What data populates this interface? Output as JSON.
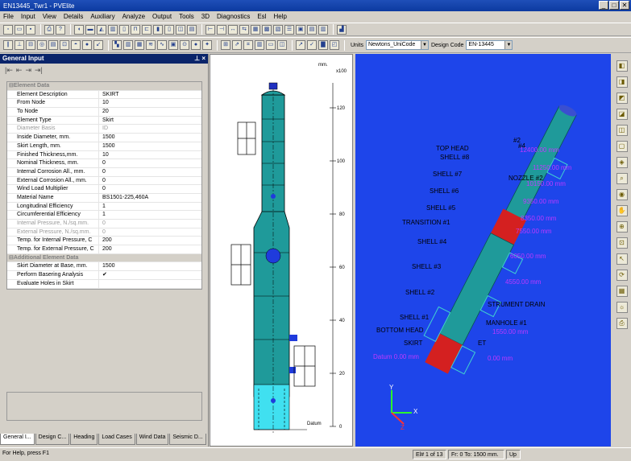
{
  "window": {
    "title": "EN13445_Twr1 - PVElite",
    "controls": [
      "_",
      "□",
      "✕"
    ]
  },
  "menu": [
    "File",
    "Input",
    "View",
    "Details",
    "Auxiliary",
    "Analyze",
    "Output",
    "Tools",
    "3D",
    "Diagnostics",
    "Esl",
    "Help"
  ],
  "toolbar": {
    "units_label": "Units",
    "units_value": "Newtons_UniCode",
    "design_code_label": "Design Code",
    "design_code_value": "EN-13445"
  },
  "panel": {
    "title": "General Input",
    "pin": "⊥ ×",
    "category_element": "Element Data",
    "category_additional": "Additional Element Data",
    "rows": [
      {
        "k": "Element Description",
        "v": "SKIRT"
      },
      {
        "k": "From Node",
        "v": "10"
      },
      {
        "k": "To Node",
        "v": "20"
      },
      {
        "k": "Element Type",
        "v": "Skirt"
      },
      {
        "k": "Diameter Basis",
        "v": "ID",
        "disabled": true
      },
      {
        "k": "Inside Diameter, mm.",
        "v": "1500"
      },
      {
        "k": "Skirt Length, mm.",
        "v": "1500"
      },
      {
        "k": "Finished Thickness,mm.",
        "v": "10"
      },
      {
        "k": "Nominal Thickness, mm.",
        "v": "0"
      },
      {
        "k": "Internal Corrosion All., mm.",
        "v": "0"
      },
      {
        "k": "External Corrosion All., mm.",
        "v": "0"
      },
      {
        "k": "Wind Load Multiplier",
        "v": "0"
      },
      {
        "k": "Material Name",
        "v": "BS1501-225,460A"
      },
      {
        "k": "Longitudinal Efficiency",
        "v": "1"
      },
      {
        "k": "Circumferential Efficiency",
        "v": "1"
      },
      {
        "k": "Internal Pressure, N./sq.mm.",
        "v": "0",
        "disabled": true
      },
      {
        "k": "External Pressure, N./sq.mm.",
        "v": "0",
        "disabled": true
      },
      {
        "k": "Temp. for Internal Pressure, C",
        "v": "200"
      },
      {
        "k": "Temp. for External Pressure, C",
        "v": "200"
      }
    ],
    "rows2": [
      {
        "k": "Skirt Diameter at Base, mm.",
        "v": "1500"
      },
      {
        "k": "Perform Basering Analysis",
        "v": "✔"
      },
      {
        "k": "Evaluate Holes in Skirt",
        "v": ""
      }
    ],
    "tabs": [
      "General I...",
      "Design C...",
      "Heading",
      "Load Cases",
      "Wind Data",
      "Seismic D..."
    ]
  },
  "elevation": {
    "unit_label": "mm.",
    "multiplier": "x100",
    "ticks": [
      "120",
      "100",
      "80",
      "60",
      "40",
      "20",
      "0"
    ],
    "datum": "Datum"
  },
  "view3d": {
    "labels": [
      "TOP HEAD",
      "SHELL #8",
      "SHELL #7",
      "SHELL #6",
      "SHELL #5",
      "TRANSITION #1",
      "SHELL #4",
      "SHELL #3",
      "SHELL #2",
      "SHELL #1",
      "BOTTOM HEAD",
      "SKIRT",
      "STRUMENT DRAIN",
      "MANHOLE #1",
      "ET",
      "NOZZLE #2",
      "#2",
      "#4"
    ],
    "dims": [
      "12400.00 mm",
      "11250.00 mm",
      "10150.00 mm",
      "9350.00 mm",
      "8350.00 mm",
      "7550.00 mm",
      "6050.00 mm",
      "4550.00 mm",
      "1550.00 mm",
      "Datum 0.00 mm",
      "0.00 mm"
    ],
    "axes": [
      "X",
      "Y",
      "Z"
    ],
    "colors": {
      "background": "#1e45ea",
      "vessel": "#1f9a9a",
      "head": "#d42020",
      "dim": "#c039ff"
    }
  },
  "status": {
    "help": "For Help, press F1",
    "element": "El# 1 of 13",
    "range": "Fr: 0 To: 1500 mm.",
    "up": "Up"
  }
}
